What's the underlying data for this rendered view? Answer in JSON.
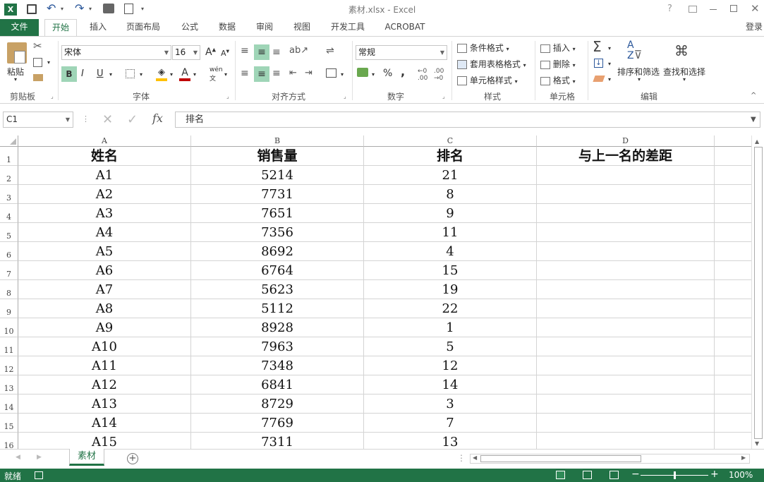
{
  "window": {
    "title": "素材.xlsx - Excel",
    "help": "?",
    "signin": "登录"
  },
  "tabs": [
    "文件",
    "开始",
    "插入",
    "页面布局",
    "公式",
    "数据",
    "审阅",
    "视图",
    "开发工具",
    "ACROBAT"
  ],
  "ribbon": {
    "clipboard": {
      "label": "剪贴板",
      "paste": "粘贴"
    },
    "font": {
      "label": "字体",
      "name": "宋体",
      "size": "16",
      "bold": "B",
      "italic": "I",
      "underline": "U",
      "grow": "A",
      "shrink": "A",
      "wen": "wén"
    },
    "alignment": {
      "label": "对齐方式"
    },
    "number": {
      "label": "数字",
      "format": "常规",
      "percent": "%",
      "comma": ","
    },
    "styles": {
      "label": "样式",
      "cond_format": "条件格式",
      "table_format": "套用表格格式",
      "cell_styles": "单元格样式"
    },
    "cells": {
      "label": "单元格",
      "insert": "插入",
      "delete": "删除",
      "format": "格式"
    },
    "editing": {
      "label": "编辑",
      "sort_filter": "排序和筛选",
      "find_select": "查找和选择",
      "sigma": "Σ"
    }
  },
  "formula_bar": {
    "name_box": "C1",
    "content": "排名"
  },
  "columns": [
    "A",
    "B",
    "C",
    "D"
  ],
  "row_numbers": [
    "1",
    "2",
    "3",
    "4",
    "5",
    "6",
    "7",
    "8",
    "9",
    "10",
    "11",
    "12",
    "13",
    "14",
    "15",
    "16"
  ],
  "table": {
    "headers": [
      "姓名",
      "销售量",
      "排名",
      "与上一名的差距"
    ],
    "rows": [
      [
        "A1",
        "5214",
        "21",
        ""
      ],
      [
        "A2",
        "7731",
        "8",
        ""
      ],
      [
        "A3",
        "7651",
        "9",
        ""
      ],
      [
        "A4",
        "7356",
        "11",
        ""
      ],
      [
        "A5",
        "8692",
        "4",
        ""
      ],
      [
        "A6",
        "6764",
        "15",
        ""
      ],
      [
        "A7",
        "5623",
        "19",
        ""
      ],
      [
        "A8",
        "5112",
        "22",
        ""
      ],
      [
        "A9",
        "8928",
        "1",
        ""
      ],
      [
        "A10",
        "7963",
        "5",
        ""
      ],
      [
        "A11",
        "7348",
        "12",
        ""
      ],
      [
        "A12",
        "6841",
        "14",
        ""
      ],
      [
        "A13",
        "8729",
        "3",
        ""
      ],
      [
        "A14",
        "7769",
        "7",
        ""
      ],
      [
        "A15",
        "7311",
        "13",
        ""
      ]
    ]
  },
  "sheet_tabs": [
    "素材"
  ],
  "status": {
    "ready": "就绪",
    "zoom": "100%",
    "zoom_level": 1.0
  },
  "colors": {
    "accent": "#217346",
    "gridline": "#d4d4d4"
  }
}
